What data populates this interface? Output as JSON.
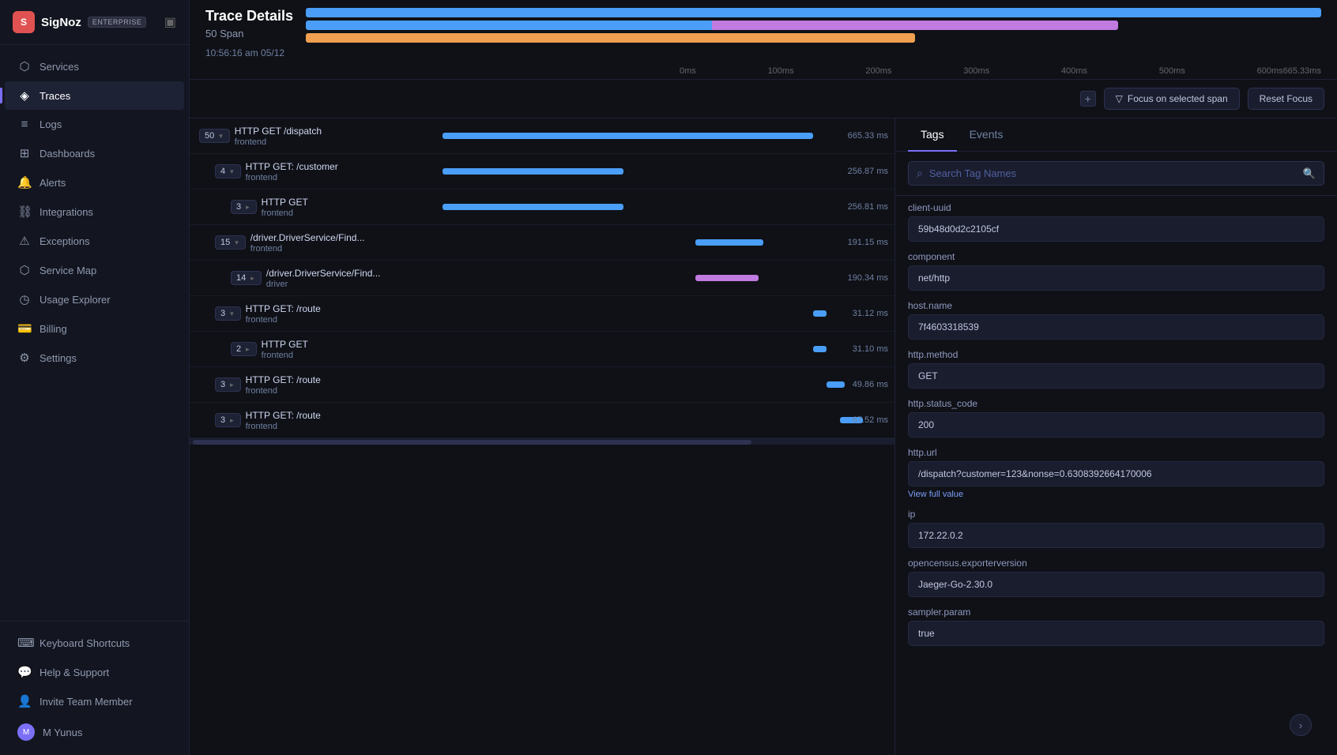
{
  "app": {
    "name": "SigNoz",
    "badge": "ENTERPRISE"
  },
  "sidebar": {
    "nav_items": [
      {
        "id": "services",
        "label": "Services",
        "icon": "⬡"
      },
      {
        "id": "traces",
        "label": "Traces",
        "icon": "◈",
        "active": true
      },
      {
        "id": "logs",
        "label": "Logs",
        "icon": "≡"
      },
      {
        "id": "dashboards",
        "label": "Dashboards",
        "icon": "⊞"
      },
      {
        "id": "alerts",
        "label": "Alerts",
        "icon": "🔔"
      },
      {
        "id": "integrations",
        "label": "Integrations",
        "icon": "⛓"
      },
      {
        "id": "exceptions",
        "label": "Exceptions",
        "icon": "⚠"
      },
      {
        "id": "service-map",
        "label": "Service Map",
        "icon": "⬡"
      },
      {
        "id": "usage-explorer",
        "label": "Usage Explorer",
        "icon": "◷"
      },
      {
        "id": "billing",
        "label": "Billing",
        "icon": "💳"
      },
      {
        "id": "settings",
        "label": "Settings",
        "icon": "⚙"
      }
    ],
    "bottom_items": [
      {
        "id": "keyboard-shortcuts",
        "label": "Keyboard Shortcuts",
        "icon": "⌨"
      },
      {
        "id": "help-support",
        "label": "Help & Support",
        "icon": "💬"
      },
      {
        "id": "invite-team",
        "label": "Invite Team Member",
        "icon": "👤"
      },
      {
        "id": "user",
        "label": "M Yunus",
        "icon": "M",
        "is_user": true
      }
    ]
  },
  "trace": {
    "title": "Trace Details",
    "span_count": "50 Span",
    "timestamp": "10:56:16 am 05/12",
    "ruler_labels": [
      "0ms",
      "100ms",
      "200ms",
      "300ms",
      "400ms",
      "500ms",
      "600ms665.33ms"
    ]
  },
  "controls": {
    "focus_btn": "Focus on selected span",
    "reset_btn": "Reset Focus"
  },
  "spans": [
    {
      "id": 1,
      "count": "50",
      "expanded": true,
      "indent": 0,
      "name": "HTTP GET /dispatch",
      "service": "frontend",
      "bar_color": "#4a9ef7",
      "bar_left": "0%",
      "bar_width": "82%",
      "duration": "665.33 ms"
    },
    {
      "id": 2,
      "count": "4",
      "expanded": true,
      "indent": 1,
      "name": "HTTP GET: /customer",
      "service": "frontend",
      "bar_color": "#4a9ef7",
      "bar_left": "0%",
      "bar_width": "40%",
      "duration": "256.87 ms"
    },
    {
      "id": 3,
      "count": "3",
      "expanded": false,
      "indent": 2,
      "name": "HTTP GET",
      "service": "frontend",
      "bar_color": "#4a9ef7",
      "bar_left": "0%",
      "bar_width": "40%",
      "duration": "256.81 ms"
    },
    {
      "id": 4,
      "count": "15",
      "expanded": true,
      "indent": 1,
      "name": "/driver.DriverService/Find...",
      "service": "frontend",
      "bar_color": "#4a9ef7",
      "bar_left": "56%",
      "bar_width": "15%",
      "duration": "191.15 ms"
    },
    {
      "id": 5,
      "count": "14",
      "expanded": false,
      "indent": 2,
      "name": "/driver.DriverService/Find...",
      "service": "driver",
      "bar_color": "#c07ae0",
      "bar_left": "56%",
      "bar_width": "14%",
      "duration": "190.34 ms"
    },
    {
      "id": 6,
      "count": "3",
      "expanded": true,
      "indent": 1,
      "name": "HTTP GET: /route",
      "service": "frontend",
      "bar_color": "#4a9ef7",
      "bar_left": "82%",
      "bar_width": "3%",
      "duration": "31.12 ms"
    },
    {
      "id": 7,
      "count": "2",
      "expanded": false,
      "indent": 2,
      "name": "HTTP GET",
      "service": "frontend",
      "bar_color": "#4a9ef7",
      "bar_left": "82%",
      "bar_width": "3%",
      "duration": "31.10 ms"
    },
    {
      "id": 8,
      "count": "3",
      "expanded": false,
      "indent": 1,
      "name": "HTTP GET: /route",
      "service": "frontend",
      "bar_color": "#4a9ef7",
      "bar_left": "85%",
      "bar_width": "4%",
      "duration": "49.86 ms"
    },
    {
      "id": 9,
      "count": "3",
      "expanded": false,
      "indent": 1,
      "name": "HTTP GET: /route",
      "service": "frontend",
      "bar_color": "#4a9ef7",
      "bar_left": "88%",
      "bar_width": "5%",
      "duration": "67.52 ms"
    }
  ],
  "tags": {
    "tab_tags": "Tags",
    "tab_events": "Events",
    "search_placeholder": "Search Tag Names",
    "items": [
      {
        "key": "client-uuid",
        "value": "59b48d0d2c2105cf",
        "type": "text"
      },
      {
        "key": "component",
        "value": "net/http",
        "type": "text"
      },
      {
        "key": "host.name",
        "value": "7f4603318539",
        "type": "text"
      },
      {
        "key": "http.method",
        "value": "GET",
        "type": "text"
      },
      {
        "key": "http.status_code",
        "value": "200",
        "type": "text"
      },
      {
        "key": "http.url",
        "value": "/dispatch?customer=123&nonse=0.6308392664170006",
        "type": "url"
      },
      {
        "key": "ip",
        "value": "172.22.0.2",
        "type": "text"
      },
      {
        "key": "opencensus.exporterversion",
        "value": "Jaeger-Go-2.30.0",
        "type": "text"
      },
      {
        "key": "sampler.param",
        "value": "true",
        "type": "text"
      }
    ],
    "view_full_label": "View full value"
  }
}
